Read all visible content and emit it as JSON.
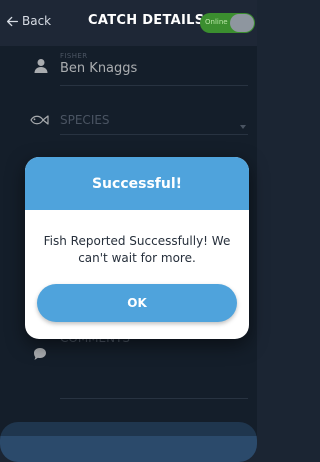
{
  "header": {
    "back_label": "Back",
    "title": "CATCH DETAILS",
    "toggle_label": "Online"
  },
  "form": {
    "fisher": {
      "label": "FISHER",
      "value": "Ben Knaggs"
    },
    "species": {
      "placeholder": "SPECIES"
    },
    "comments": {
      "placeholder": "COMMENTS"
    }
  },
  "dialog": {
    "title": "Successful!",
    "message": "Fish Reported Successfully! We can't wait for more.",
    "ok_label": "OK"
  },
  "colors": {
    "accent": "#4fa3dc",
    "background": "#1b2533",
    "toggle_on": "#3b8e2f"
  }
}
